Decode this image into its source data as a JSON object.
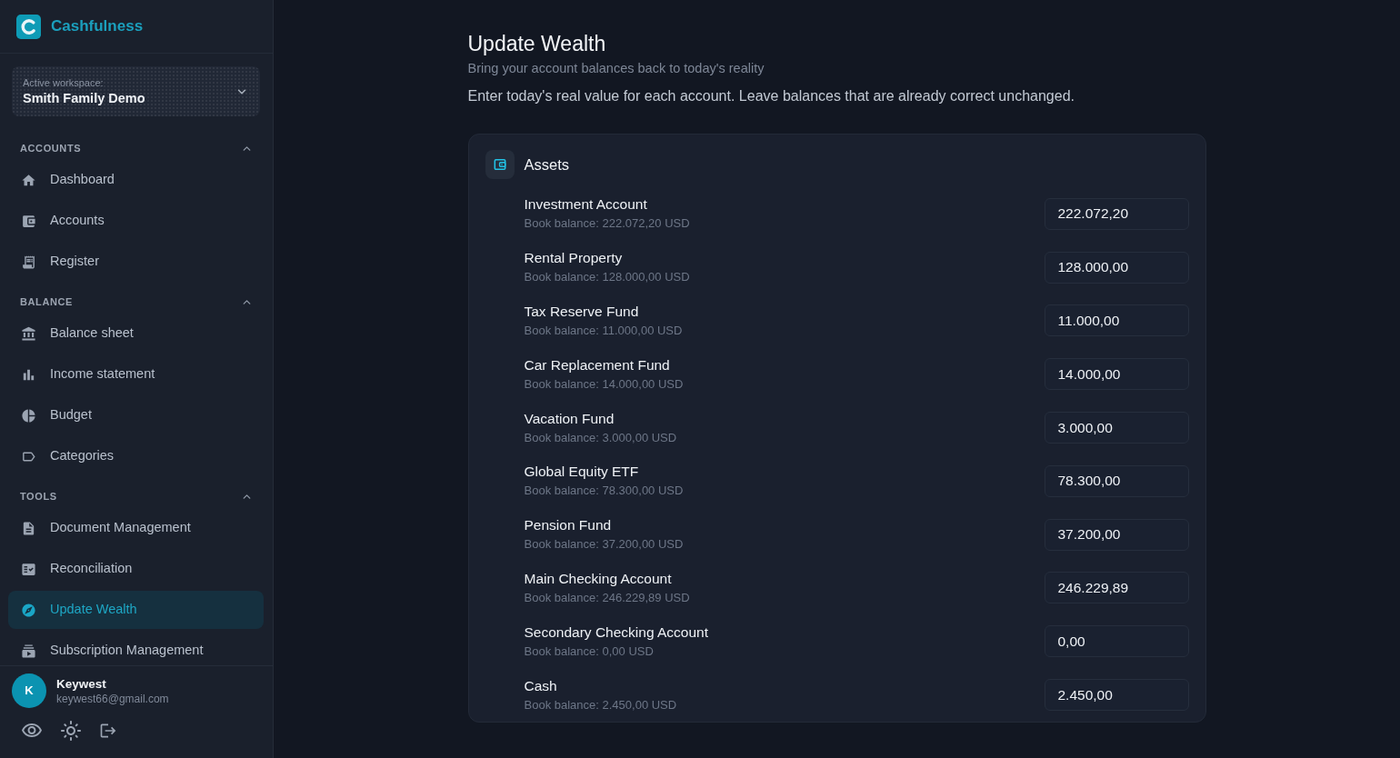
{
  "sidebar": {
    "brand": "Cashfulness",
    "workspace": {
      "label": "Active workspace:",
      "name": "Smith Family Demo"
    },
    "sections": [
      {
        "title": "ACCOUNTS",
        "expanded": true,
        "items": [
          {
            "label": "Dashboard",
            "selected": false
          },
          {
            "label": "Accounts",
            "selected": false
          },
          {
            "label": "Register",
            "selected": false
          }
        ]
      },
      {
        "title": "BALANCE",
        "expanded": true,
        "items": [
          {
            "label": "Balance sheet",
            "selected": false
          },
          {
            "label": "Income statement",
            "selected": false
          },
          {
            "label": "Budget",
            "selected": false
          },
          {
            "label": "Categories",
            "selected": false
          }
        ]
      },
      {
        "title": "TOOLS",
        "expanded": true,
        "items": [
          {
            "label": "Document Management",
            "selected": false
          },
          {
            "label": "Reconciliation",
            "selected": false
          },
          {
            "label": "Update Wealth",
            "selected": true
          },
          {
            "label": "Subscription Management",
            "selected": false
          }
        ]
      }
    ],
    "user": {
      "initial": "K",
      "name": "Keywest",
      "email": "keywest66@gmail.com"
    }
  },
  "page": {
    "title": "Update Wealth",
    "subtitle": "Bring your account balances back to today's reality",
    "instructions": "Enter today's real value for each account. Leave balances that are already correct unchanged."
  },
  "assets": {
    "title": "Assets",
    "accounts": [
      {
        "name": "Investment Account",
        "book_balance": "Book balance: 222.072,20 USD",
        "value": "222.072,20"
      },
      {
        "name": "Rental Property",
        "book_balance": "Book balance: 128.000,00 USD",
        "value": "128.000,00"
      },
      {
        "name": "Tax Reserve Fund",
        "book_balance": "Book balance: 11.000,00 USD",
        "value": "11.000,00"
      },
      {
        "name": "Car Replacement Fund",
        "book_balance": "Book balance: 14.000,00 USD",
        "value": "14.000,00"
      },
      {
        "name": "Vacation Fund",
        "book_balance": "Book balance: 3.000,00 USD",
        "value": "3.000,00"
      },
      {
        "name": "Global Equity ETF",
        "book_balance": "Book balance: 78.300,00 USD",
        "value": "78.300,00"
      },
      {
        "name": "Pension Fund",
        "book_balance": "Book balance: 37.200,00 USD",
        "value": "37.200,00"
      },
      {
        "name": "Main Checking Account",
        "book_balance": "Book balance: 246.229,89 USD",
        "value": "246.229,89"
      },
      {
        "name": "Secondary Checking Account",
        "book_balance": "Book balance: 0,00 USD",
        "value": "0,00"
      },
      {
        "name": "Cash",
        "book_balance": "Book balance: 2.450,00 USD",
        "value": "2.450,00"
      }
    ]
  }
}
